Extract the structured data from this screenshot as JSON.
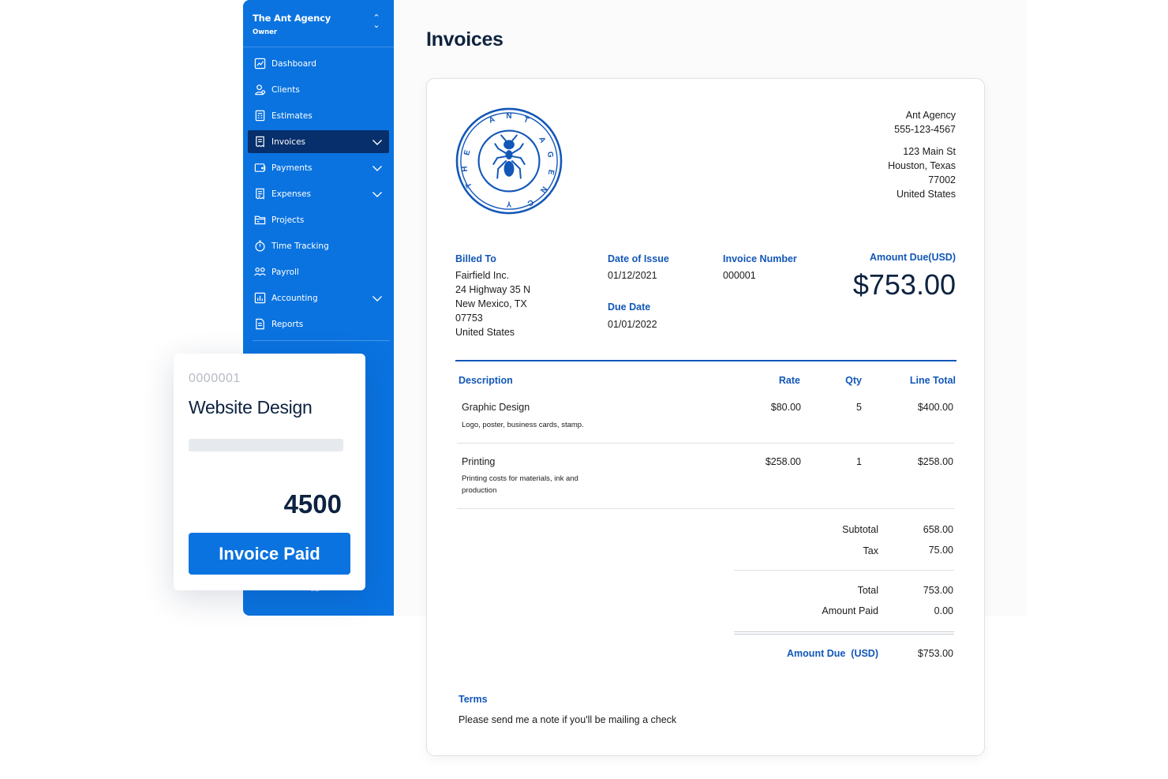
{
  "app": {
    "account_name": "The Ant Agency",
    "account_role": "Owner",
    "page_title": "Invoices",
    "accent_color": "#0a73e0",
    "active_color": "#072f6b"
  },
  "sidebar": {
    "items": [
      {
        "label": "Dashboard",
        "icon": "dashboard-icon"
      },
      {
        "label": "Clients",
        "icon": "clients-icon"
      },
      {
        "label": "Estimates",
        "icon": "estimates-icon"
      },
      {
        "label": "Invoices",
        "icon": "invoices-icon",
        "active": true,
        "expandable": true
      },
      {
        "label": "Payments",
        "icon": "payments-icon",
        "expandable": true
      },
      {
        "label": "Expenses",
        "icon": "expenses-icon",
        "expandable": true
      },
      {
        "label": "Projects",
        "icon": "projects-icon"
      },
      {
        "label": "Time Tracking",
        "icon": "time-tracking-icon"
      },
      {
        "label": "Payroll",
        "icon": "payroll-icon"
      },
      {
        "label": "Accounting",
        "icon": "accounting-icon",
        "expandable": true
      },
      {
        "label": "Reports",
        "icon": "reports-icon"
      }
    ]
  },
  "card": {
    "number": "0000001",
    "title": "Website Design",
    "amount": "4500",
    "button_label": "Invoice Paid"
  },
  "invoice": {
    "seal_text": "THE ANT AGENCY",
    "from": {
      "name": "Ant Agency",
      "phone": "555-123-4567",
      "street": "123 Main St",
      "city_state": "Houston, Texas",
      "zip": "77002",
      "country": "United States"
    },
    "billed_to_label": "Billed To",
    "billed_to": {
      "name": "Fairfield Inc.",
      "street": "24 Highway 35 N",
      "city_state": "New Mexico, TX",
      "zip": "07753",
      "country": "United States"
    },
    "date_of_issue_label": "Date of Issue",
    "date_of_issue": "01/12/2021",
    "due_date_label": "Due Date",
    "due_date": "01/01/2022",
    "invoice_number_label": "Invoice Number",
    "invoice_number": "000001",
    "amount_due_label": "Amount Due(USD)",
    "amount_due": "$753.00",
    "columns": {
      "description": "Description",
      "rate": "Rate",
      "qty": "Qty",
      "line_total": "Line Total"
    },
    "items": [
      {
        "name": "Graphic Design",
        "desc": "Logo, poster, business cards, stamp.",
        "rate": "$80.00",
        "qty": "5",
        "total": "$400.00"
      },
      {
        "name": "Printing",
        "desc": "Printing costs for materials, ink and production",
        "rate": "$258.00",
        "qty": "1",
        "total": "$258.00"
      }
    ],
    "summary": {
      "subtotal_label": "Subtotal",
      "subtotal": "658.00",
      "tax_label": "Tax",
      "tax": "75.00",
      "total_label": "Total",
      "total": "753.00",
      "paid_label": "Amount Paid",
      "paid": "0.00",
      "due_label": "Amount Due  (USD)",
      "due": "$753.00"
    },
    "terms_label": "Terms",
    "terms": "Please send me a note if you'll be mailing a check"
  }
}
